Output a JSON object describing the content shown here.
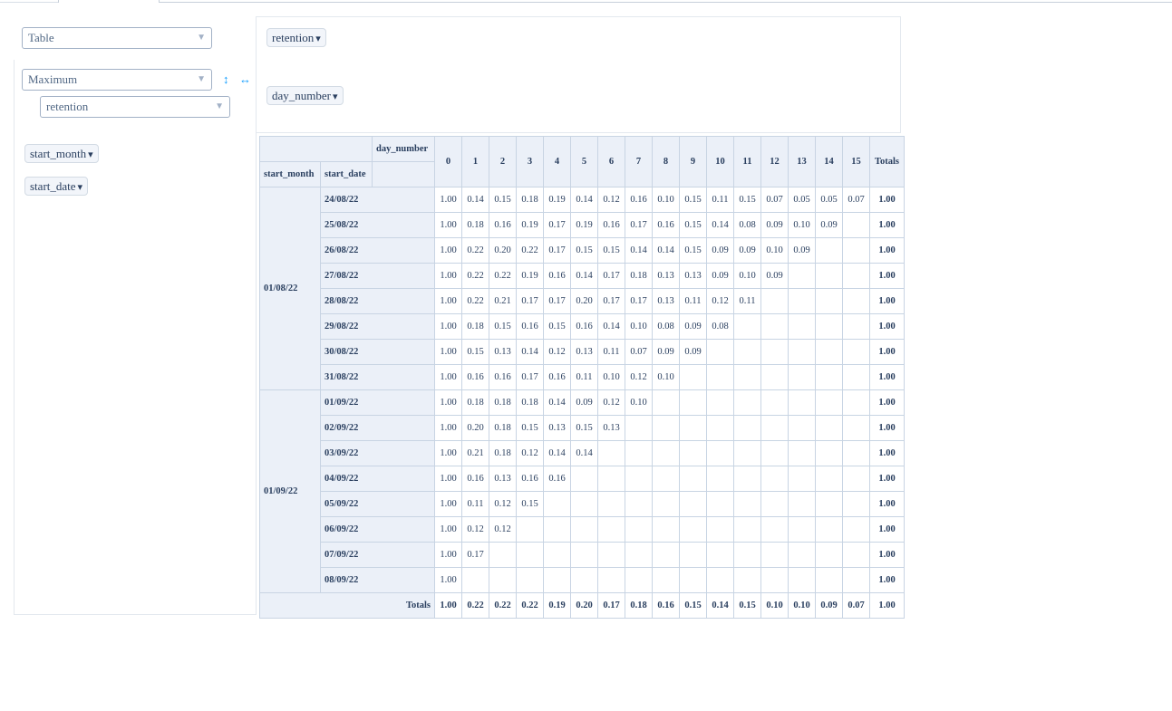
{
  "renderer": {
    "value": "Table"
  },
  "aggregator": {
    "value": "Maximum",
    "attribute": "retention"
  },
  "col_attrs": [
    {
      "label": "retention"
    }
  ],
  "row_attrs_right": [
    {
      "label": "day_number"
    }
  ],
  "row_attrs": [
    {
      "label": "start_month"
    },
    {
      "label": "start_date"
    }
  ],
  "table": {
    "col_attr_label": "day_number",
    "row_attr_labels": [
      "start_month",
      "start_date"
    ],
    "col_keys": [
      "0",
      "1",
      "2",
      "3",
      "4",
      "5",
      "6",
      "7",
      "8",
      "9",
      "10",
      "11",
      "12",
      "13",
      "14",
      "15"
    ],
    "totals_label": "Totals",
    "groups": [
      {
        "month": "01/08/22",
        "rows": [
          {
            "date": "24/08/22",
            "values": [
              "1.00",
              "0.14",
              "0.15",
              "0.18",
              "0.19",
              "0.14",
              "0.12",
              "0.16",
              "0.10",
              "0.15",
              "0.11",
              "0.15",
              "0.07",
              "0.05",
              "0.05",
              "0.07"
            ],
            "total": "1.00"
          },
          {
            "date": "25/08/22",
            "values": [
              "1.00",
              "0.18",
              "0.16",
              "0.19",
              "0.17",
              "0.19",
              "0.16",
              "0.17",
              "0.16",
              "0.15",
              "0.14",
              "0.08",
              "0.09",
              "0.10",
              "0.09",
              ""
            ],
            "total": "1.00"
          },
          {
            "date": "26/08/22",
            "values": [
              "1.00",
              "0.22",
              "0.20",
              "0.22",
              "0.17",
              "0.15",
              "0.15",
              "0.14",
              "0.14",
              "0.15",
              "0.09",
              "0.09",
              "0.10",
              "0.09",
              "",
              ""
            ],
            "total": "1.00"
          },
          {
            "date": "27/08/22",
            "values": [
              "1.00",
              "0.22",
              "0.22",
              "0.19",
              "0.16",
              "0.14",
              "0.17",
              "0.18",
              "0.13",
              "0.13",
              "0.09",
              "0.10",
              "0.09",
              "",
              "",
              ""
            ],
            "total": "1.00"
          },
          {
            "date": "28/08/22",
            "values": [
              "1.00",
              "0.22",
              "0.21",
              "0.17",
              "0.17",
              "0.20",
              "0.17",
              "0.17",
              "0.13",
              "0.11",
              "0.12",
              "0.11",
              "",
              "",
              "",
              ""
            ],
            "total": "1.00"
          },
          {
            "date": "29/08/22",
            "values": [
              "1.00",
              "0.18",
              "0.15",
              "0.16",
              "0.15",
              "0.16",
              "0.14",
              "0.10",
              "0.08",
              "0.09",
              "0.08",
              "",
              "",
              "",
              "",
              ""
            ],
            "total": "1.00"
          },
          {
            "date": "30/08/22",
            "values": [
              "1.00",
              "0.15",
              "0.13",
              "0.14",
              "0.12",
              "0.13",
              "0.11",
              "0.07",
              "0.09",
              "0.09",
              "",
              "",
              "",
              "",
              "",
              ""
            ],
            "total": "1.00"
          },
          {
            "date": "31/08/22",
            "values": [
              "1.00",
              "0.16",
              "0.16",
              "0.17",
              "0.16",
              "0.11",
              "0.10",
              "0.12",
              "0.10",
              "",
              "",
              "",
              "",
              "",
              "",
              ""
            ],
            "total": "1.00"
          }
        ]
      },
      {
        "month": "01/09/22",
        "rows": [
          {
            "date": "01/09/22",
            "values": [
              "1.00",
              "0.18",
              "0.18",
              "0.18",
              "0.14",
              "0.09",
              "0.12",
              "0.10",
              "",
              "",
              "",
              "",
              "",
              "",
              "",
              ""
            ],
            "total": "1.00"
          },
          {
            "date": "02/09/22",
            "values": [
              "1.00",
              "0.20",
              "0.18",
              "0.15",
              "0.13",
              "0.15",
              "0.13",
              "",
              "",
              "",
              "",
              "",
              "",
              "",
              "",
              ""
            ],
            "total": "1.00"
          },
          {
            "date": "03/09/22",
            "values": [
              "1.00",
              "0.21",
              "0.18",
              "0.12",
              "0.14",
              "0.14",
              "",
              "",
              "",
              "",
              "",
              "",
              "",
              "",
              "",
              ""
            ],
            "total": "1.00"
          },
          {
            "date": "04/09/22",
            "values": [
              "1.00",
              "0.16",
              "0.13",
              "0.16",
              "0.16",
              "",
              "",
              "",
              "",
              "",
              "",
              "",
              "",
              "",
              "",
              ""
            ],
            "total": "1.00"
          },
          {
            "date": "05/09/22",
            "values": [
              "1.00",
              "0.11",
              "0.12",
              "0.15",
              "",
              "",
              "",
              "",
              "",
              "",
              "",
              "",
              "",
              "",
              "",
              ""
            ],
            "total": "1.00"
          },
          {
            "date": "06/09/22",
            "values": [
              "1.00",
              "0.12",
              "0.12",
              "",
              "",
              "",
              "",
              "",
              "",
              "",
              "",
              "",
              "",
              "",
              "",
              ""
            ],
            "total": "1.00"
          },
          {
            "date": "07/09/22",
            "values": [
              "1.00",
              "0.17",
              "",
              "",
              "",
              "",
              "",
              "",
              "",
              "",
              "",
              "",
              "",
              "",
              "",
              ""
            ],
            "total": "1.00"
          },
          {
            "date": "08/09/22",
            "values": [
              "1.00",
              "",
              "",
              "",
              "",
              "",
              "",
              "",
              "",
              "",
              "",
              "",
              "",
              "",
              "",
              ""
            ],
            "total": "1.00"
          }
        ]
      }
    ],
    "col_totals": [
      "1.00",
      "0.22",
      "0.22",
      "0.22",
      "0.19",
      "0.20",
      "0.17",
      "0.18",
      "0.16",
      "0.15",
      "0.14",
      "0.15",
      "0.10",
      "0.10",
      "0.09",
      "0.07"
    ],
    "grand_total": "1.00"
  },
  "icons": {
    "sort_rows": "vertical-arrows-icon",
    "sort_cols": "horizontal-arrows-icon",
    "dropdown": "triangle-down-icon"
  },
  "colors": {
    "accent": "#119dff",
    "header_bg": "#ebf0f8",
    "border": "#c8d4e3",
    "text": "#2a3f5f"
  }
}
